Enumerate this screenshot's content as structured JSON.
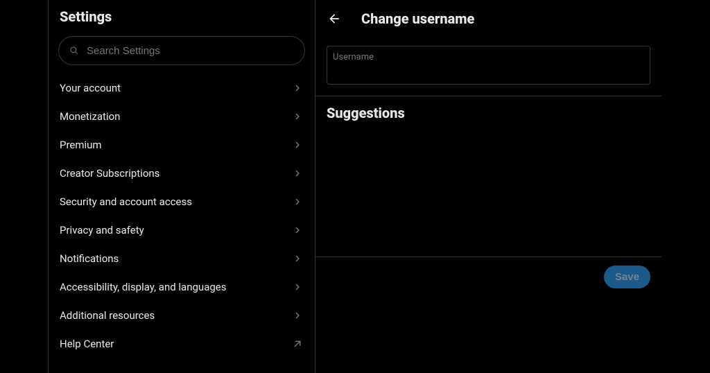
{
  "sidebar": {
    "title": "Settings",
    "search_placeholder": "Search Settings",
    "items": [
      {
        "label": "Your account",
        "icon": "chevron"
      },
      {
        "label": "Monetization",
        "icon": "chevron"
      },
      {
        "label": "Premium",
        "icon": "chevron"
      },
      {
        "label": "Creator Subscriptions",
        "icon": "chevron"
      },
      {
        "label": "Security and account access",
        "icon": "chevron"
      },
      {
        "label": "Privacy and safety",
        "icon": "chevron"
      },
      {
        "label": "Notifications",
        "icon": "chevron"
      },
      {
        "label": "Accessibility, display, and languages",
        "icon": "chevron"
      },
      {
        "label": "Additional resources",
        "icon": "chevron"
      },
      {
        "label": "Help Center",
        "icon": "external"
      }
    ]
  },
  "detail": {
    "title": "Change username",
    "username_label": "Username",
    "username_value": "",
    "suggestions_title": "Suggestions",
    "save_label": "Save"
  }
}
